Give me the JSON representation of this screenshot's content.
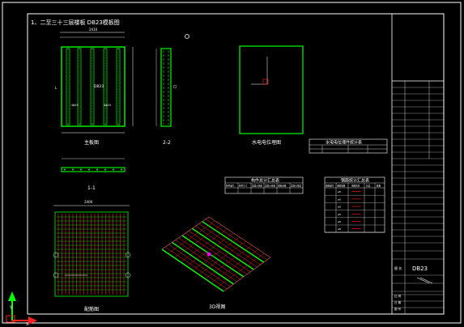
{
  "sheet": {
    "title": "1、二至三十三层楼板 DB23模板图"
  },
  "views": {
    "top_plan": {
      "caption": "主板图",
      "overall_dim": "2410",
      "left_dim": "L",
      "mid_label": "DB23",
      "bottom_labels": [
        "4ø10",
        "4ø10"
      ]
    },
    "section_22": {
      "caption": "2-2"
    },
    "section_11": {
      "caption": "1-1"
    },
    "water_elec": {
      "caption": "水电电位埋图"
    },
    "reinf_plan": {
      "caption": "配筋图",
      "top_dim": "2400"
    },
    "three_d": {
      "caption": "3D视图"
    }
  },
  "tables": {
    "water_elec_table": {
      "title": "水电电位埋件统计表"
    },
    "component_table": {
      "title": "构件总计汇总表",
      "headers": [
        "构件编号",
        "构件尺寸",
        "混凝土体积",
        "混凝土重量",
        "钢筋用量",
        "混凝土强度"
      ]
    },
    "rebar_table": {
      "title": "钢筋统计汇总表",
      "headers": [
        "钢筋编号",
        "钢筋规格",
        "钢筋形状",
        "长度",
        "数量"
      ],
      "specs": [
        "ø8",
        "ø8",
        "ø8",
        "ø8",
        "ø8",
        "ø8"
      ]
    }
  },
  "title_block": {
    "drawing_no_label": "图 名",
    "drawing_no": "DB23",
    "scale_label": "比 例",
    "date_label": "日 期",
    "sheet_label": "图 号"
  },
  "colors": {
    "background": "#000000",
    "frame": "#ffffff",
    "rebar": "#00ff00",
    "accent_red": "#ff2020",
    "accent_magenta": "#ff00ff",
    "dimension": "#ffffff"
  },
  "ucs": {
    "y_label": "Y",
    "x_label": "X"
  }
}
